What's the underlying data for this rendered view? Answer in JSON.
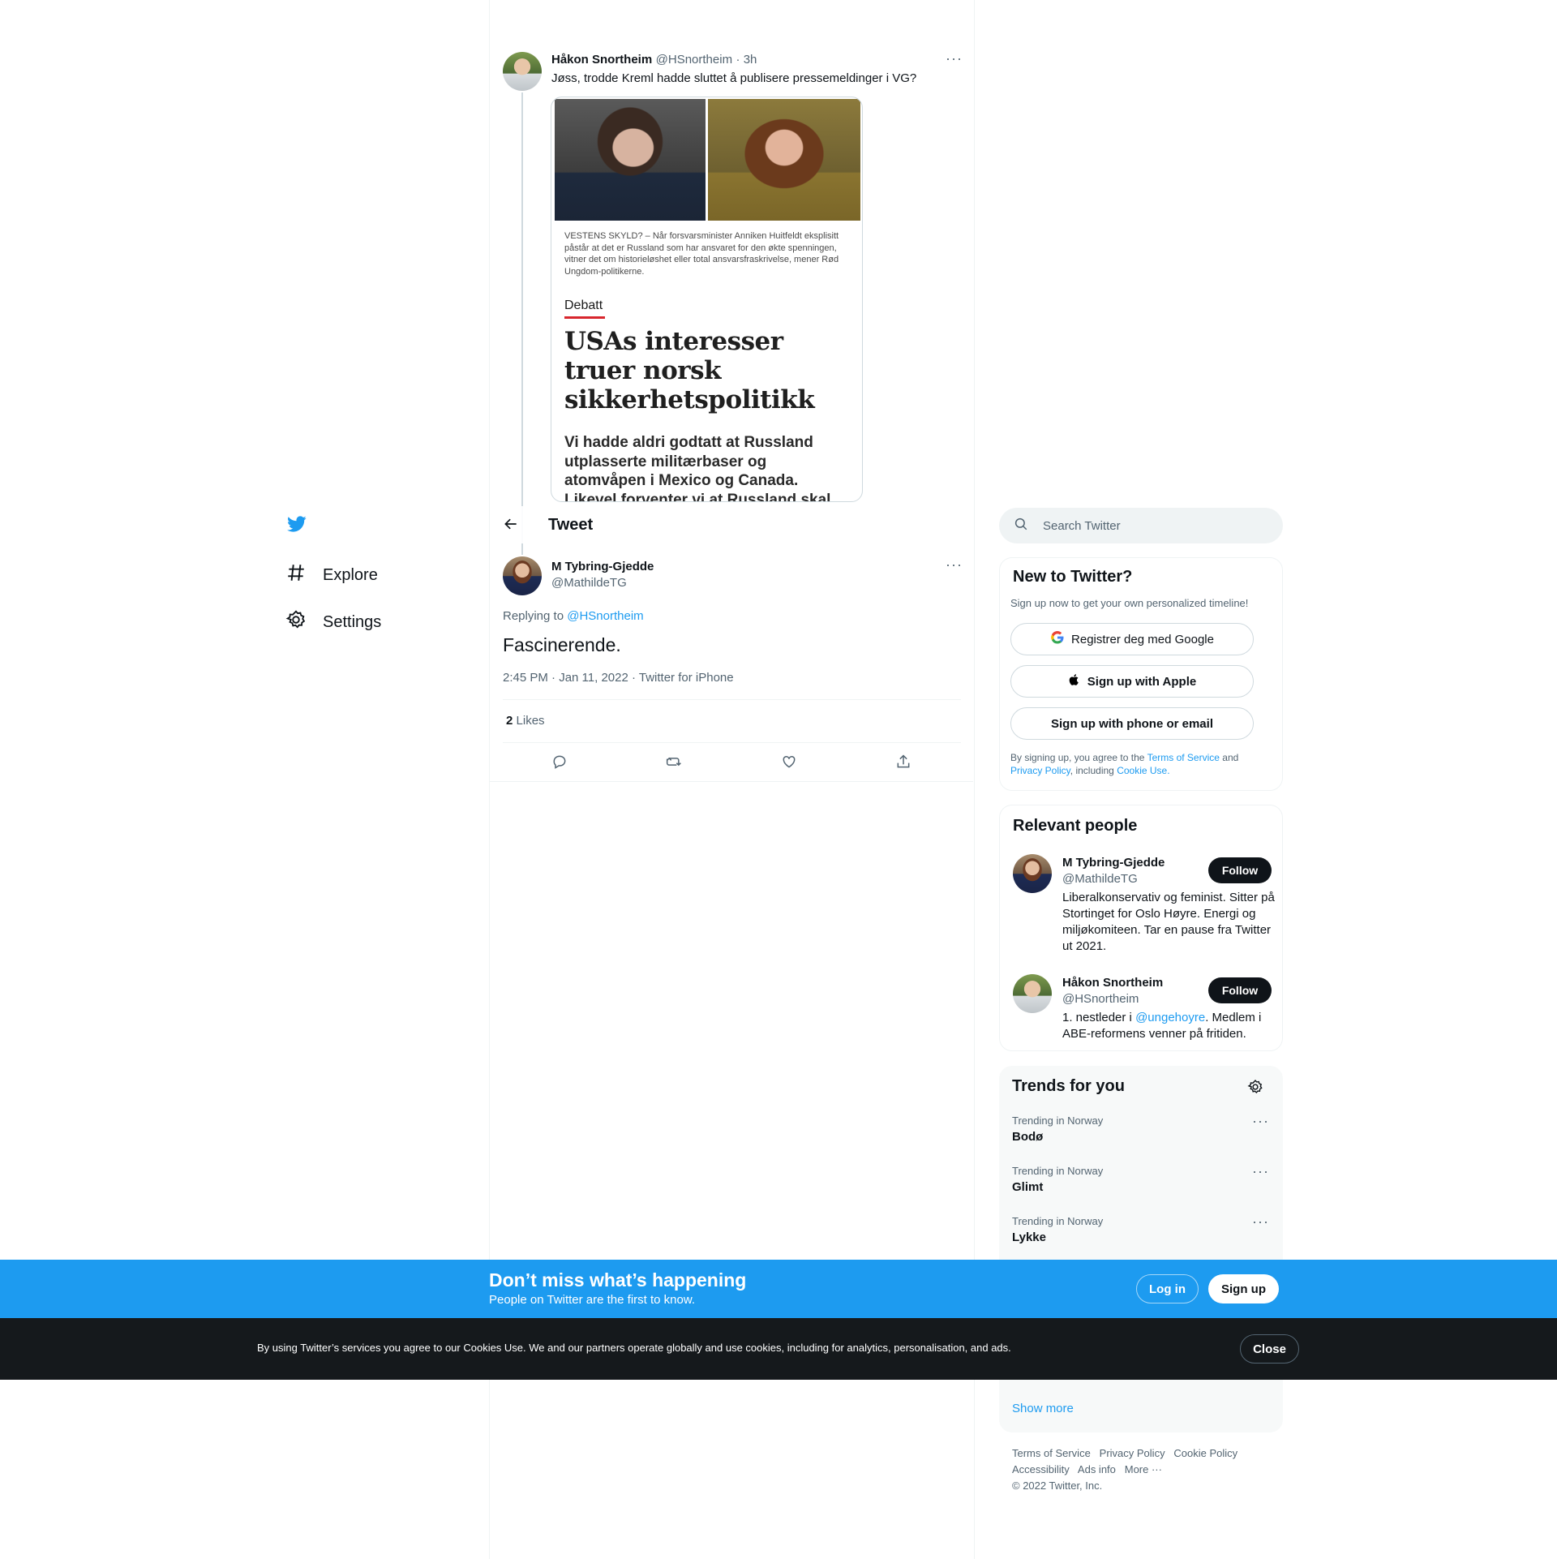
{
  "nav": {
    "explore_label": "Explore",
    "settings_label": "Settings"
  },
  "parent_tweet": {
    "name": "Håkon Snortheim",
    "handle": "@HSnortheim",
    "time": "· 3h",
    "text": "Jøss, trodde Kreml hadde sluttet å publisere pressemeldinger i VG?",
    "article": {
      "caption": "VESTENS SKYLD? – Når forsvarsminister Anniken Huitfeldt eksplisitt påstår at det er Russland som har ansvaret for den økte spenningen, vitner det om historieløshet eller total ansvarsfraskrivelse, mener Rød Ungdom-politikerne.",
      "section": "Debatt",
      "headline": "USAs interesser truer norsk sikkerhetspolitikk",
      "lead": "Vi hadde aldri godtatt at Russland utplasserte militærbaser og atomvåpen i Mexico og Canada. Likevel forventer vi at Russland skal"
    }
  },
  "header": {
    "title": "Tweet"
  },
  "main_tweet": {
    "name": "M Tybring-Gjedde",
    "handle": "@MathildeTG",
    "replying_prefix": "Replying to",
    "replying_to": "@HSnortheim",
    "text": "Fascinerende.",
    "meta": "2:45 PM · Jan 11, 2022 · Twitter for iPhone",
    "likes_count": "2",
    "likes_label": "Likes"
  },
  "search": {
    "placeholder": "Search Twitter"
  },
  "signup_card": {
    "title": "New to Twitter?",
    "subtitle": "Sign up now to get your own personalized timeline!",
    "google_label": "Registrer deg med Google",
    "apple_label": "Sign up with Apple",
    "phone_label": "Sign up with phone or email",
    "legal_1": "By signing up, you agree to the",
    "terms": "Terms of Service",
    "legal_and": "and",
    "privacy": "Privacy Policy",
    "legal_including": ", including",
    "cookie": "Cookie Use."
  },
  "relevant_people": {
    "title": "Relevant people",
    "people": [
      {
        "name": "M Tybring-Gjedde",
        "handle": "@MathildeTG",
        "bio": "Liberalkonservativ og feminist. Sitter på Stortinget for Oslo Høyre. Energi og miljøkomiteen. Tar en pause fra Twitter ut 2021.",
        "follow_label": "Follow"
      },
      {
        "name": "Håkon Snortheim",
        "handle": "@HSnortheim",
        "bio_prefix": "1. nestleder i",
        "bio_mention": "@ungehoyre",
        "bio_suffix": ". Medlem i ABE-reformens venner på fritiden.",
        "follow_label": "Follow"
      }
    ]
  },
  "trends": {
    "title": "Trends for you",
    "items": [
      {
        "context": "Trending in Norway",
        "name": "Bodø"
      },
      {
        "context": "Trending in Norway",
        "name": "Glimt"
      },
      {
        "context": "Trending in Norway",
        "name": "Lykke"
      }
    ],
    "show_more": "Show more"
  },
  "footer": {
    "terms": "Terms of Service",
    "privacy": "Privacy Policy",
    "cookie": "Cookie Policy",
    "accessibility": "Accessibility",
    "ads": "Ads info",
    "more": "More ···",
    "copyright": "© 2022 Twitter, Inc."
  },
  "login_banner": {
    "title": "Don’t miss what’s happening",
    "subtitle": "People on Twitter are the first to know.",
    "login_label": "Log in",
    "signup_label": "Sign up"
  },
  "cookie_banner": {
    "text": "By using Twitter’s services you agree to our Cookies Use. We and our partners operate globally and use cookies, including for analytics, personalisation, and ads.",
    "close_label": "Close"
  },
  "colors": {
    "brand": "#1d9bf0",
    "dark": "#0f1419",
    "secondary_text": "#536471"
  }
}
